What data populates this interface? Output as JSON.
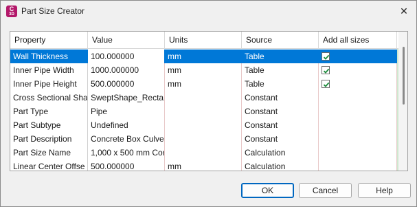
{
  "window": {
    "title": "Part Size Creator",
    "app_icon_letter": "C",
    "app_icon_sub": "3D"
  },
  "grid": {
    "columns": [
      "Property",
      "Value",
      "Units",
      "Source",
      "Add all sizes"
    ],
    "rows": [
      {
        "property": "Wall Thickness",
        "value": "100.000000",
        "units": "mm",
        "source": "Table",
        "add_all": true
      },
      {
        "property": "Inner Pipe Width",
        "value": "1000.000000",
        "units": "mm",
        "source": "Table",
        "add_all": true
      },
      {
        "property": "Inner Pipe Height",
        "value": "500.000000",
        "units": "mm",
        "source": "Table",
        "add_all": true
      },
      {
        "property": "Cross Sectional Sha",
        "value": "SweptShape_Rectar",
        "units": "",
        "source": "Constant",
        "add_all": null
      },
      {
        "property": "Part Type",
        "value": "Pipe",
        "units": "",
        "source": "Constant",
        "add_all": null
      },
      {
        "property": "Part Subtype",
        "value": "Undefined",
        "units": "",
        "source": "Constant",
        "add_all": null
      },
      {
        "property": "Part Description",
        "value": "Concrete Box Culve",
        "units": "",
        "source": "Constant",
        "add_all": null
      },
      {
        "property": "Part Size Name",
        "value": "1,000 x 500 mm Cor",
        "units": "",
        "source": "Calculation",
        "add_all": null
      },
      {
        "property": "Linear Center Offse",
        "value": "500.000000",
        "units": "mm",
        "source": "Calculation",
        "add_all": null
      }
    ],
    "selected_row": 0
  },
  "buttons": {
    "ok": "OK",
    "cancel": "Cancel",
    "help": "Help"
  },
  "colors": {
    "selection": "#0078d7",
    "app_icon": "#b3186a",
    "check": "#1a8a3a"
  }
}
